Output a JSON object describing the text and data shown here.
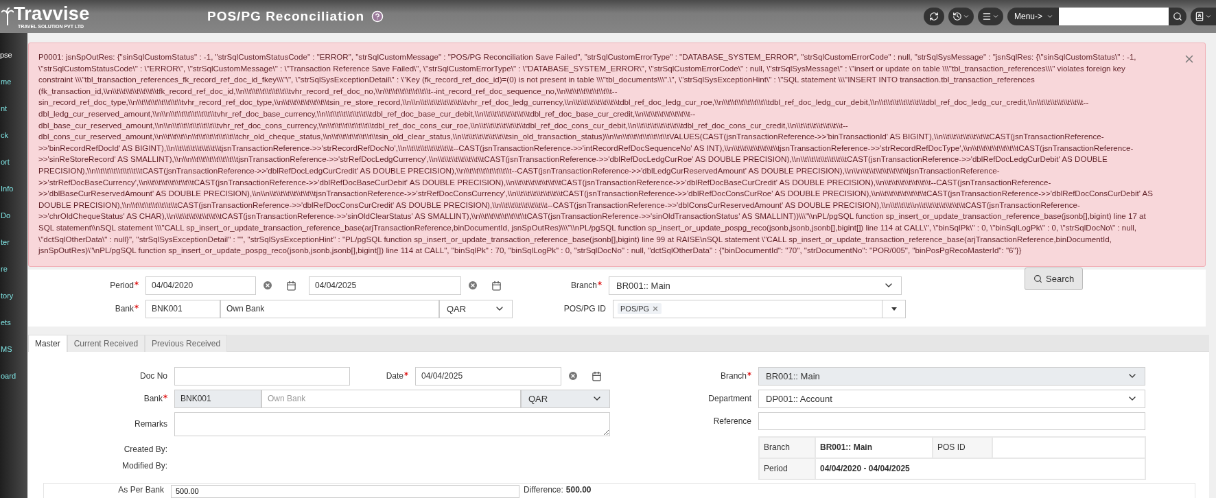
{
  "header": {
    "logo": "Travvise",
    "tagline": "TRAVEL SOLUTION PVT LTD",
    "title": "POS/PG Reconciliation",
    "menu_label": "Menu->"
  },
  "sidebar": {
    "items": [
      {
        "label": "pse",
        "kind": "toggle"
      },
      {
        "label": "me",
        "kind": "link"
      },
      {
        "label": "nt",
        "kind": "link"
      },
      {
        "label": "ck",
        "kind": "link"
      },
      {
        "label": "ort",
        "kind": "link"
      },
      {
        "label": "Info",
        "kind": "link"
      },
      {
        "label": "Do",
        "kind": "link"
      },
      {
        "label": "ter",
        "kind": "link"
      },
      {
        "label": "re",
        "kind": "link"
      },
      {
        "label": "tory",
        "kind": "link"
      },
      {
        "label": "ets",
        "kind": "link"
      },
      {
        "label": "MS",
        "kind": "link"
      },
      {
        "label": "oard",
        "kind": "link"
      }
    ]
  },
  "alert": {
    "message": "P0001: jsnSpOutRes: {\"sinSqlCustomStatus\" : -1, \"strSqlCustomStatusCode\" : \"ERROR\", \"strSqlCustomMessage\" : \"POS/PG Reconciliation Save Failed\", \"strSqlCustomErrorType\" : \"DATABASE_SYSTEM_ERROR\", \"strSqlCustomErrorCode\" : null, \"strSqlSysMessage\" : \"jsnSqlRes: {\\\"sinSqlCustomStatus\\\" : -1, \\\"strSqlCustomStatusCode\\\" : \\\"ERROR\\\", \\\"strSqlCustomMessage\\\" : \\\"Transaction Reference Save Failed\\\", \\\"strSqlCustomErrorType\\\" : \\\"DATABASE_SYSTEM_ERROR\\\", \\\"strSqlCustomErrorCode\\\" : null, \\\"strSqlSysMessage\\\" : \\\"insert or update on table \\\\\\\"tbl_transaction_references\\\\\\\" violates foreign key constraint \\\\\\\"tbl_transaction_references_fk_record_ref_doc_id_fkey\\\\\\\"\\\", \\\"strSqlSysExceptionDetail\\\" : \\\"Key (fk_record_ref_doc_id)=(0) is not present in table \\\\\\\"tbl_documents\\\\\\\".\\\", \\\"strSqlSysExceptionHint\\\" : \\\"SQL statement \\\\\\\"INSERT INTO transaction.tbl_transaction_references (fk_transaction_id,\\\\n\\\\t\\\\t\\\\t\\\\t\\\\t\\\\t\\\\tfk_record_ref_doc_id,\\\\n\\\\t\\\\t\\\\t\\\\t\\\\t\\\\t\\\\tvhr_record_ref_doc_no,\\\\n\\\\t\\\\t\\\\t\\\\t\\\\t\\\\t\\\\t--int_record_ref_doc_sequence_no,\\\\n\\\\t\\\\t\\\\t\\\\t\\\\t\\\\t\\\\t--sin_record_ref_doc_type,\\\\n\\\\t\\\\t\\\\t\\\\t\\\\t\\\\t\\\\tvhr_record_ref_doc_type,\\\\n\\\\t\\\\t\\\\t\\\\t\\\\t\\\\t\\\\tsin_re_store_record,\\\\n\\\\n\\\\t\\\\t\\\\t\\\\t\\\\t\\\\t\\\\tvhr_ref_doc_ledg_currency,\\\\n\\\\t\\\\t\\\\t\\\\t\\\\t\\\\t\\\\tdbl_ref_doc_ledg_cur_roe,\\\\n\\\\t\\\\t\\\\t\\\\t\\\\t\\\\t\\\\tdbl_ref_doc_ledg_cur_debit,\\\\n\\\\t\\\\t\\\\t\\\\t\\\\t\\\\t\\\\tdbl_ref_doc_ledg_cur_credit,\\\\n\\\\t\\\\t\\\\t\\\\t\\\\t\\\\t\\\\t--dbl_ledg_cur_reserved_amount,\\\\n\\\\n\\\\t\\\\t\\\\t\\\\t\\\\t\\\\t\\\\tvhr_ref_doc_base_currency,\\\\n\\\\t\\\\t\\\\t\\\\t\\\\t\\\\t\\\\tdbl_ref_doc_base_cur_debit,\\\\n\\\\t\\\\t\\\\t\\\\t\\\\t\\\\t\\\\tdbl_ref_doc_base_cur_credit,\\\\n\\\\t\\\\t\\\\t\\\\t\\\\t\\\\t\\\\t--dbl_base_cur_reserved_amount,\\\\n\\\\n\\\\t\\\\t\\\\t\\\\t\\\\t\\\\t\\\\tvhr_ref_doc_cons_currency,\\\\n\\\\t\\\\t\\\\t\\\\t\\\\t\\\\t\\\\tdbl_ref_doc_cons_cur_roe,\\\\n\\\\t\\\\t\\\\t\\\\t\\\\t\\\\t\\\\tdbl_ref_doc_cons_cur_debit,\\\\n\\\\t\\\\t\\\\t\\\\t\\\\t\\\\t\\\\tdbl_ref_doc_cons_cur_credit,\\\\n\\\\t\\\\t\\\\t\\\\t\\\\t\\\\t\\\\t--dbl_cons_cur_reserved_amount,\\\\n\\\\t\\\\t\\\\t\\\\n\\\\t\\\\t\\\\t\\\\t\\\\t\\\\t\\\\tchr_old_cheque_status,\\\\n\\\\t\\\\t\\\\t\\\\t\\\\t\\\\t\\\\tsin_old_clear_status,\\\\n\\\\t\\\\t\\\\t\\\\t\\\\t\\\\t\\\\tsin_old_transaction_status)\\\\n\\\\n\\\\t\\\\t\\\\t\\\\t\\\\t\\\\t\\\\tVALUES(CAST(jsnTransactionReference->>'binTransactionId' AS BIGINT),\\\\n\\\\t\\\\t\\\\t\\\\t\\\\t\\\\t\\\\tCAST(jsnTransactionReference->>'binRecordRefDocId' AS BIGINT),\\\\n\\\\t\\\\t\\\\t\\\\t\\\\t\\\\t\\\\tjsnTransactionReference->>'strRecordRefDocNo',\\\\n\\\\t\\\\t\\\\t\\\\t\\\\t\\\\t\\\\t--CAST(jsnTransactionReference->>'intRecordRefDocSequenceNo' AS INT),\\\\n\\\\t\\\\t\\\\t\\\\t\\\\t\\\\t\\\\tjsnTransactionReference->>'strRecordRefDocType',\\\\n\\\\t\\\\t\\\\t\\\\t\\\\t\\\\t\\\\tCAST(jsnTransactionReference->>'sinReStoreRecord' AS SMALLINT),\\\\n\\\\n\\\\t\\\\t\\\\t\\\\t\\\\t\\\\t\\\\tjsnTransactionReference->>'strRefDocLedgCurrency',\\\\n\\\\t\\\\t\\\\t\\\\t\\\\t\\\\t\\\\tCAST(jsnTransactionReference->>'dblRefDocLedgCurRoe' AS DOUBLE PRECISION),\\\\n\\\\t\\\\t\\\\t\\\\t\\\\t\\\\t\\\\tCAST(jsnTransactionReference->>'dblRefDocLedgCurDebit' AS DOUBLE PRECISION),\\\\n\\\\t\\\\t\\\\t\\\\t\\\\t\\\\t\\\\tCAST(jsnTransactionReference->>'dblRefDocLedgCurCredit' AS DOUBLE PRECISION),\\\\n\\\\t\\\\t\\\\t\\\\t\\\\t\\\\t\\\\t--CAST(jsnTransactionReference->>'dblLedgCurReservedAmount' AS DOUBLE PRECISION),\\\\n\\\\n\\\\t\\\\t\\\\t\\\\t\\\\t\\\\t\\\\tjsnTransactionReference->>'strRefDocBaseCurrency',\\\\n\\\\t\\\\t\\\\t\\\\t\\\\t\\\\t\\\\tCAST(jsnTransactionReference->>'dblRefDocBaseCurDebit' AS DOUBLE PRECISION),\\\\n\\\\t\\\\t\\\\t\\\\t\\\\t\\\\t\\\\tCAST(jsnTransactionReference->>'dblRefDocBaseCurCredit' AS DOUBLE PRECISION),\\\\n\\\\t\\\\t\\\\t\\\\t\\\\t\\\\t\\\\t--CAST(jsnTransactionReference->>'dblBaseCurReservedAmount' AS DOUBLE PRECISION),\\\\n\\\\n\\\\t\\\\t\\\\t\\\\t\\\\t\\\\t\\\\tjsnTransactionReference->>'strRefDocConsCurrency',\\\\n\\\\t\\\\t\\\\t\\\\t\\\\t\\\\t\\\\tCAST(jsnTransactionReference->>'dblRefDocConsCurRoe' AS DOUBLE PRECISION),\\\\n\\\\t\\\\t\\\\t\\\\t\\\\t\\\\t\\\\tCAST(jsnTransactionReference->>'dblRefDocConsCurDebit' AS DOUBLE PRECISION),\\\\n\\\\t\\\\t\\\\t\\\\t\\\\t\\\\t\\\\tCAST(jsnTransactionReference->>'dblRefDocConsCurCredit' AS DOUBLE PRECISION),\\\\n\\\\t\\\\t\\\\t\\\\t\\\\t\\\\t\\\\t--CAST(jsnTransactionReference->>'dblConsCurReservedAmount' AS DOUBLE PRECISION),\\\\n\\\\t\\\\t\\\\t\\\\n\\\\t\\\\t\\\\t\\\\t\\\\t\\\\t\\\\tCAST(jsnTransactionReference->>'chrOldChequeStatus' AS CHAR),\\\\n\\\\t\\\\t\\\\t\\\\t\\\\t\\\\t\\\\tCAST(jsnTransactionReference->>'sinOldClearStatus' AS SMALLINT),\\\\n\\\\t\\\\t\\\\t\\\\t\\\\t\\\\t\\\\tCAST(jsnTransactionReference->>'sinOldTransactionStatus' AS SMALLINT))\\\\\\\"\\\\nPL/pgSQL function sp_insert_or_update_transaction_reference_base(jsonb[],bigint) line 17 at SQL statement\\\\nSQL statement \\\\\\\"CALL sp_insert_or_update_transaction_reference_base(arjTransactionReference,binDocumentId, jsnSpOutRes)\\\\\\\"\\\\nPL/pgSQL function sp_insert_or_update_pospg_reco(jsonb,jsonb,jsonb[],bigint[]) line 114 at CALL\\\", \\\"binSqlPk\\\" : 0, \\\"binSqlLogPk\\\" : 0, \\\"strSqlDocNo\\\" : null, \\\"dctSqlOtherData\\\" : null}\", \"strSqlSysExceptionDetail\" : \"\", \"strSqlSysExceptionHint\" : \"PL/pgSQL function sp_insert_or_update_transaction_reference_base(jsonb[],bigint) line 99 at RAISE\\nSQL statement \\\"CALL sp_insert_or_update_transaction_reference_base(arjTransactionReference,binDocumentId, jsnSpOutRes)\\\"\\nPL/pgSQL function sp_insert_or_update_pospg_reco(jsonb,jsonb,jsonb[],bigint[]) line 114 at CALL\", \"binSqlPk\" : 70, \"binSqlLogPk\" : 0, \"strSqlDocNo\" : null, \"dctSqlOtherData\" : {\"binDocumentId\": \"70\", \"strDocumentNo\": \"POR/005\", \"binPosPgRecoMasterId\": \"6\"}}"
  },
  "filter": {
    "period": {
      "label": "Period",
      "required": true,
      "from": "04/04/2020",
      "to": "04/04/2025"
    },
    "branch": {
      "label": "Branch",
      "required": true,
      "value": "BR001:: Main"
    },
    "bank": {
      "label": "Bank",
      "required": true,
      "code": "BNK001",
      "name": "Own Bank",
      "currency": "QAR"
    },
    "pospg": {
      "label": "POS/PG ID",
      "tags": [
        "POS/PG"
      ]
    },
    "search_button": "Search"
  },
  "tabs": [
    {
      "label": "Master",
      "selected": true
    },
    {
      "label": "Current Received",
      "selected": false
    },
    {
      "label": "Previous Received",
      "selected": false
    }
  ],
  "master": {
    "doc_no": {
      "label": "Doc No"
    },
    "date": {
      "label": "Date",
      "required": true,
      "value": "04/04/2025"
    },
    "branch": {
      "label": "Branch",
      "required": true,
      "disabled": true,
      "value": "BR001:: Main"
    },
    "bank": {
      "label": "Bank",
      "required": true,
      "disabled": true,
      "code": "BNK001",
      "name_placeholder": "Own Bank",
      "currency": "QAR"
    },
    "department": {
      "label": "Department",
      "value": "DP001:: Account"
    },
    "remarks": {
      "label": "Remarks"
    },
    "reference": {
      "label": "Reference"
    },
    "created_by": {
      "label": "Created By:"
    },
    "modified_by": {
      "label": "Modified By:"
    },
    "info": {
      "branch": {
        "label": "Branch",
        "value": "BR001:: Main"
      },
      "pos_id": {
        "label": "POS ID"
      },
      "period": {
        "label": "Period",
        "value": "04/04/2020 - 04/04/2025"
      }
    }
  },
  "summary": {
    "as_per_bank": {
      "label": "As Per Bank",
      "value": "500.00"
    },
    "difference": {
      "label": "Difference:",
      "value": "500.00"
    }
  }
}
